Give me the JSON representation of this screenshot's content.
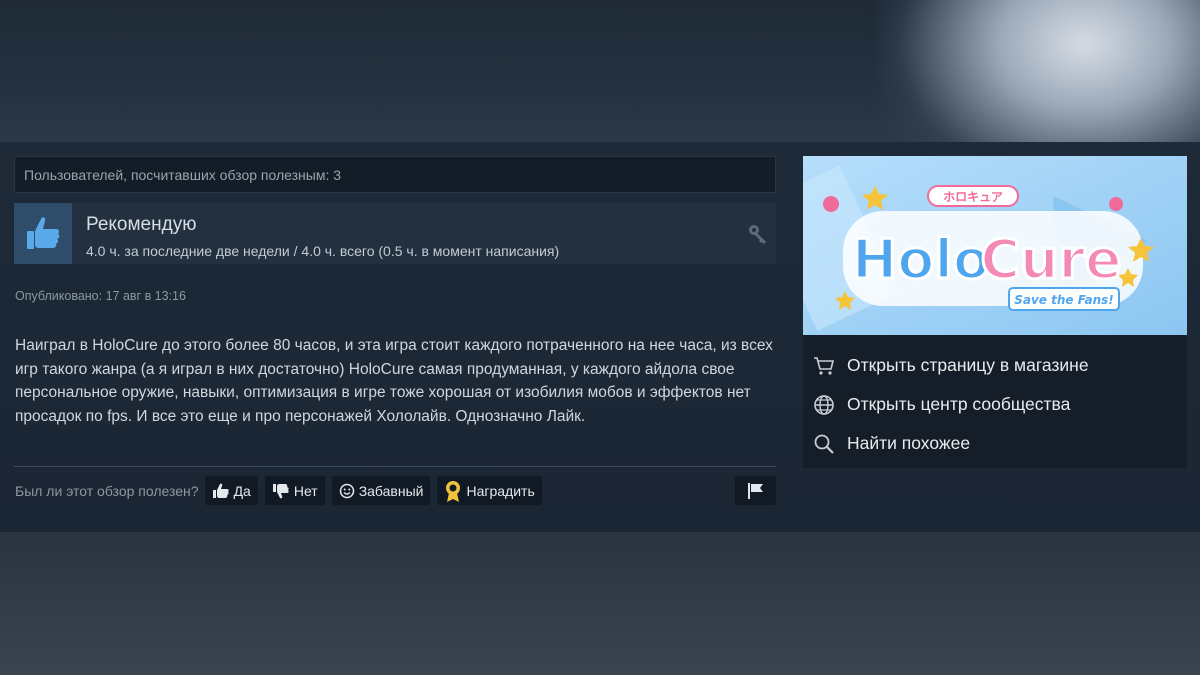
{
  "helpful_count_text": "Пользователей, посчитавших обзор полезным: 3",
  "recommendation": {
    "title": "Рекомендую",
    "hours": "4.0 ч. за последние две недели / 4.0 ч. всего (0.5 ч. в момент написания)"
  },
  "posted": "Опубликовано: 17 авг в 13:16",
  "review_body": "Наиграл в HoloCure до этого более 80 часов, и эта игра стоит каждого потраченного на нее часа, из всех игр такого жанра (а я играл в них достаточно) HoloCure самая продуманная, у каждого айдола свое персональное оружие, навыки, оптимизация в игре тоже хорошая от изобилия мобов и эффектов нет просадок по fps. И все это еще и про персонажей Хололайв. Однозначно Лайк.",
  "vote": {
    "question": "Был ли этот обзор полезен?",
    "yes": "Да",
    "no": "Нет",
    "funny": "Забавный",
    "award": "Наградить"
  },
  "banner": {
    "jp_tag": "ホロキュア",
    "logo_holo": "Holo",
    "logo_cure": "Cure",
    "tagline": "Save the Fans!"
  },
  "side_links": [
    {
      "label": "Открыть страницу в магазине",
      "icon": "cart-icon"
    },
    {
      "label": "Открыть центр сообщества",
      "icon": "globe-icon"
    },
    {
      "label": "Найти похожее",
      "icon": "search-icon"
    }
  ],
  "colors": {
    "background": "#1b2838",
    "panel": "#233040",
    "thumb_bg": "#2f4d6b",
    "button_bg": "#111a24",
    "award_gold": "#f0c23a"
  }
}
